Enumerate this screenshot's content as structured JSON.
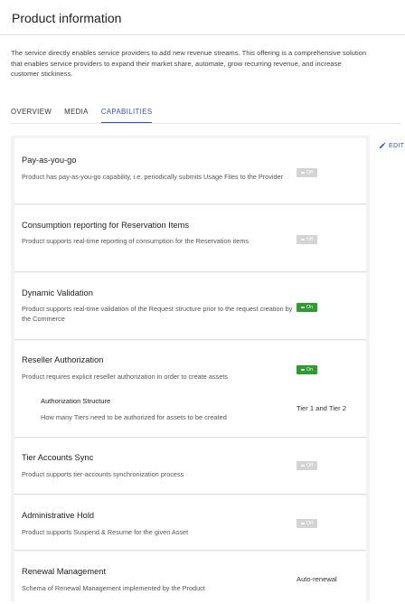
{
  "header": {
    "title": "Product information"
  },
  "description": "The service directly enables service providers to add new revenue streams. This offering is a comprehensive solution that enables service providers to expand their market share, automate, grow recurring revenue, and increase customer stickiness.",
  "tabs": [
    {
      "label": "OVERVIEW",
      "active": false
    },
    {
      "label": "MEDIA",
      "active": false
    },
    {
      "label": "CAPABILITIES",
      "active": true
    }
  ],
  "edit_label": "EDIT",
  "capabilities": [
    {
      "title": "Pay-as-you-go",
      "description": "Product has pay-as-you-go capability, i.e. periodically submits Usage Files to the Provider",
      "state": "Off"
    },
    {
      "title": "Consumption reporting for Reservation Items",
      "description": "Product supports real-time reporting of consumption for the Reservation items",
      "state": "Off"
    },
    {
      "title": "Dynamic Validation",
      "description": "Product supports real-time validation of the Request structure prior to the request creation by the Commerce",
      "state": "On"
    },
    {
      "title": "Reseller Authorization",
      "description": "Product requires explicit reseller authorization in order to create assets",
      "state": "On",
      "sub": {
        "title": "Authorization Structure",
        "description": "How many Tiers need to be authorized for assets to be created",
        "value": "Tier 1 and Tier 2"
      }
    },
    {
      "title": "Tier Accounts Sync",
      "description": "Product supports tier-accounts synchronization process",
      "state": "Off"
    },
    {
      "title": "Administrative Hold",
      "description": "Product supports Suspend & Resume for the given Asset",
      "state": "Off"
    },
    {
      "title": "Renewal Management",
      "description": "Schema of Renewal Management implemented by the Product",
      "value": "Auto-renewal"
    }
  ],
  "colors": {
    "accent": "#3551c7",
    "toggle_on": "#2e9c2e",
    "toggle_off": "#d4d4d4"
  }
}
